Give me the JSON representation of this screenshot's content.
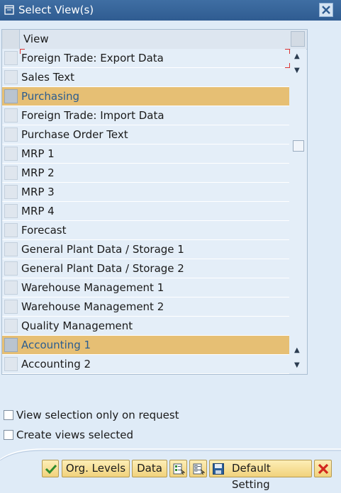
{
  "window": {
    "title": "Select View(s)",
    "icon": "dialog-window-icon",
    "close_icon": "close-icon"
  },
  "table": {
    "column_header": "View",
    "rows": [
      {
        "label": "Foreign Trade: Export Data",
        "selected": false,
        "focused": true
      },
      {
        "label": "Sales Text",
        "selected": false
      },
      {
        "label": "Purchasing",
        "selected": true
      },
      {
        "label": "Foreign Trade: Import Data",
        "selected": false
      },
      {
        "label": "Purchase Order Text",
        "selected": false
      },
      {
        "label": "MRP 1",
        "selected": false
      },
      {
        "label": "MRP 2",
        "selected": false
      },
      {
        "label": "MRP 3",
        "selected": false
      },
      {
        "label": "MRP 4",
        "selected": false
      },
      {
        "label": "Forecast",
        "selected": false
      },
      {
        "label": "General Plant Data / Storage 1",
        "selected": false
      },
      {
        "label": "General Plant Data / Storage 2",
        "selected": false
      },
      {
        "label": "Warehouse Management 1",
        "selected": false
      },
      {
        "label": "Warehouse Management 2",
        "selected": false
      },
      {
        "label": "Quality Management",
        "selected": false
      },
      {
        "label": "Accounting 1",
        "selected": true
      },
      {
        "label": "Accounting 2",
        "selected": false
      }
    ],
    "selected_row_color": "#e6bf74",
    "row_color": "#e4eef8"
  },
  "options": {
    "view_selection_only_on_request": {
      "label": "View selection only on request",
      "checked": false
    },
    "create_views_selected": {
      "label": "Create views selected",
      "checked": false
    }
  },
  "toolbar": {
    "confirm_icon": "checkmark-icon",
    "org_levels_label": "Org. Levels",
    "data_label": "Data",
    "select_all_icon": "select-all-icon",
    "deselect_all_icon": "deselect-all-icon",
    "save_icon": "save-floppy-icon",
    "default_setting_label": "Default Setting",
    "cancel_icon": "cancel-x-icon"
  },
  "colors": {
    "titlebar": "#345f94",
    "background": "#dfebf7",
    "button": "#f6dc8f",
    "accent_text": "#2b5d91"
  }
}
